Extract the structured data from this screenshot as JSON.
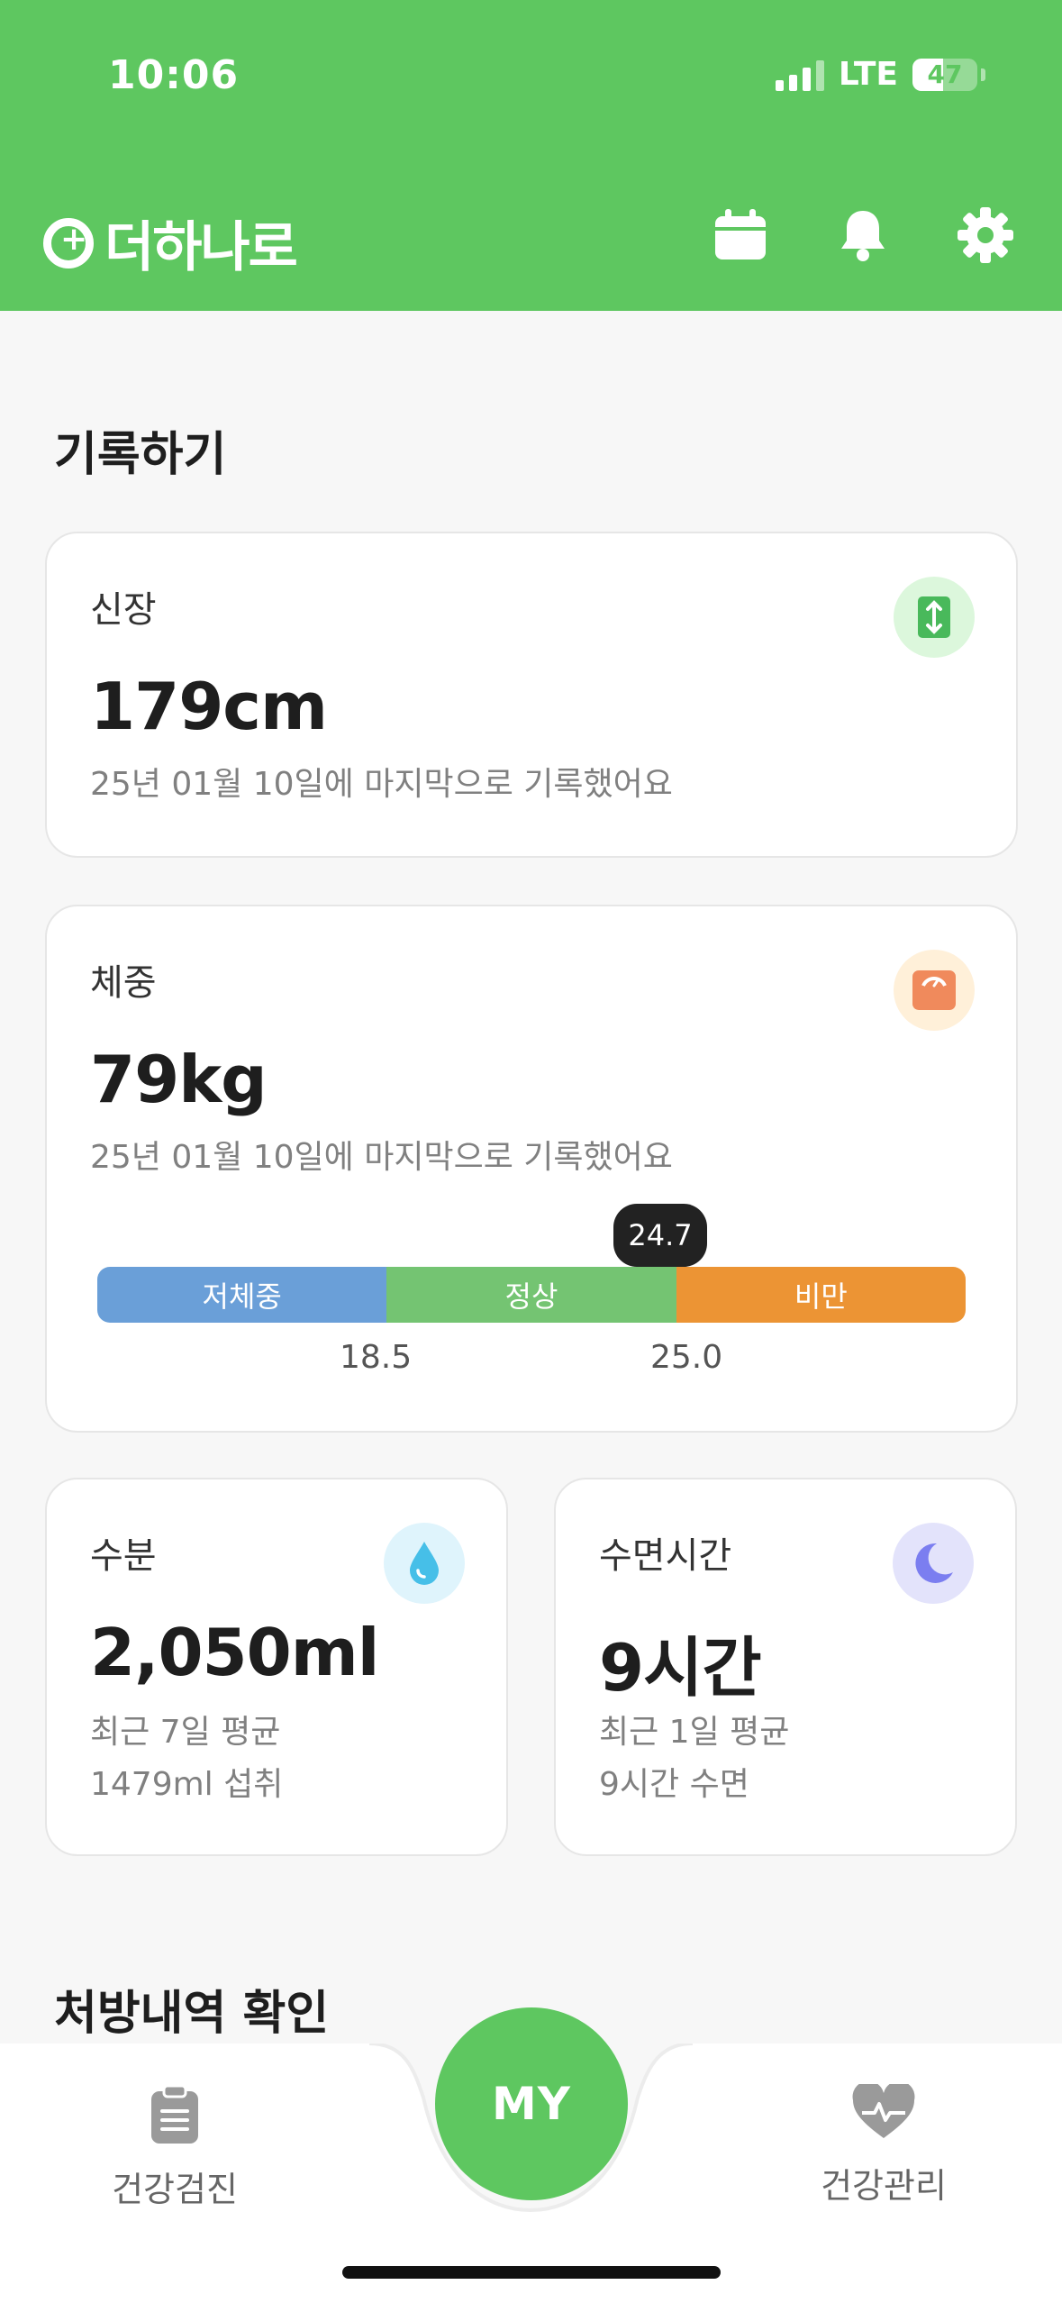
{
  "status_bar": {
    "time": "10:06",
    "network": "LTE",
    "battery_level": "47"
  },
  "header": {
    "app_name": "더하나로",
    "icons": [
      "calendar-icon",
      "bell-icon",
      "gear-icon"
    ],
    "brand_color": "#5ec760"
  },
  "record_section": {
    "title": "기록하기",
    "height_card": {
      "label": "신장",
      "value": "179cm",
      "last_recorded": "25년 01월 10일에 마지막으로 기록했어요",
      "icon": "height-icon",
      "icon_bg": "#dcf7dc"
    },
    "weight_card": {
      "label": "체중",
      "value": "79kg",
      "last_recorded": "25년 01월 10일에 마지막으로 기록했어요",
      "icon": "scale-icon",
      "icon_bg": "#fff0d9",
      "bmi": {
        "value": "24.7",
        "value_fraction": 0.65,
        "segments": [
          {
            "label": "저체중",
            "color": "#6a9fd8"
          },
          {
            "label": "정상",
            "color": "#74c472"
          },
          {
            "label": "비만",
            "color": "#ec9434"
          }
        ],
        "thresholds": [
          "18.5",
          "25.0"
        ]
      }
    },
    "water_card": {
      "label": "수분",
      "value": "2,050ml",
      "sub_line1": "최근 7일 평균",
      "sub_line2": "1479ml 섭취",
      "icon": "water-drop-icon",
      "icon_bg": "#dff4fc"
    },
    "sleep_card": {
      "label": "수면시간",
      "value": "9시간",
      "sub_line1": "최근 1일 평균",
      "sub_line2": "9시간 수면",
      "icon": "moon-icon",
      "icon_bg": "#e3e3fb"
    }
  },
  "prescription_section": {
    "title": "처방내역 확인"
  },
  "bottom_nav": {
    "left": {
      "label": "건강검진",
      "icon": "clipboard-icon"
    },
    "center": {
      "label": "MY"
    },
    "right": {
      "label": "건강관리",
      "icon": "heart-pulse-icon"
    }
  }
}
